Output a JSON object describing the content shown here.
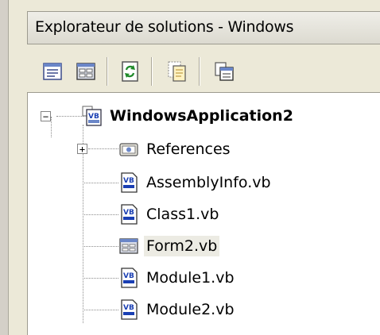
{
  "window": {
    "title": "Explorateur de solutions - Windows"
  },
  "toolbar": {
    "buttons": [
      {
        "name": "properties-icon"
      },
      {
        "name": "view-designer-icon"
      },
      {
        "name": "refresh-icon"
      },
      {
        "name": "show-all-files-icon"
      },
      {
        "name": "view-class-diagram-icon"
      }
    ]
  },
  "tree": {
    "root": {
      "label": "WindowsApplication2",
      "expanded": true,
      "icon": "vb-project-icon"
    },
    "items": [
      {
        "label": "References",
        "icon": "references-icon",
        "expandable": true
      },
      {
        "label": "AssemblyInfo.vb",
        "icon": "vb-file-icon"
      },
      {
        "label": "Class1.vb",
        "icon": "vb-file-icon"
      },
      {
        "label": "Form2.vb",
        "icon": "form-icon",
        "selected": true
      },
      {
        "label": "Module1.vb",
        "icon": "vb-file-icon"
      },
      {
        "label": "Module2.vb",
        "icon": "vb-file-icon"
      }
    ]
  },
  "colors": {
    "chrome": "#ece9d8",
    "selection": "#ecebe3",
    "vb_blue": "#1a3fb3"
  }
}
